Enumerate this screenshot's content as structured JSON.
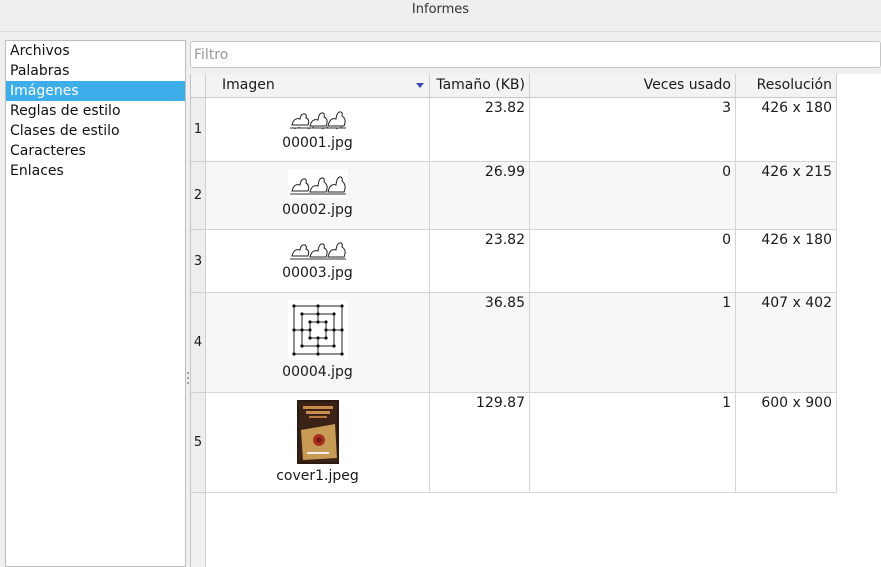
{
  "window": {
    "title": "Informes"
  },
  "sidebar": {
    "items": [
      {
        "label": "Archivos",
        "selected": false
      },
      {
        "label": "Palabras",
        "selected": false
      },
      {
        "label": "Imágenes",
        "selected": true
      },
      {
        "label": "Reglas de estilo",
        "selected": false
      },
      {
        "label": "Clases de estilo",
        "selected": false
      },
      {
        "label": "Caracteres",
        "selected": false
      },
      {
        "label": "Enlaces",
        "selected": false
      }
    ]
  },
  "filter": {
    "placeholder": "Filtro",
    "value": ""
  },
  "table": {
    "headers": {
      "image": "Imagen",
      "size": "Tamaño (KB)",
      "used": "Veces usado",
      "resolution": "Resolución"
    },
    "sort_column": "image",
    "rows": [
      {
        "num": "1",
        "file": "00001.jpg",
        "size": "23.82",
        "used": "3",
        "resolution": "426 x 180",
        "thumb": "geese-illustration"
      },
      {
        "num": "2",
        "file": "00002.jpg",
        "size": "26.99",
        "used": "0",
        "resolution": "426 x 215",
        "thumb": "geese-illustration"
      },
      {
        "num": "3",
        "file": "00003.jpg",
        "size": "23.82",
        "used": "0",
        "resolution": "426 x 180",
        "thumb": "geese-illustration"
      },
      {
        "num": "4",
        "file": "00004.jpg",
        "size": "36.85",
        "used": "1",
        "resolution": "407 x 402",
        "thumb": "board-diagram"
      },
      {
        "num": "5",
        "file": "cover1.jpeg",
        "size": "129.87",
        "used": "1",
        "resolution": "600 x 900",
        "thumb": "book-cover"
      }
    ]
  },
  "colors": {
    "selection": "#3daee9",
    "sort_indicator": "#3a4bb0"
  }
}
